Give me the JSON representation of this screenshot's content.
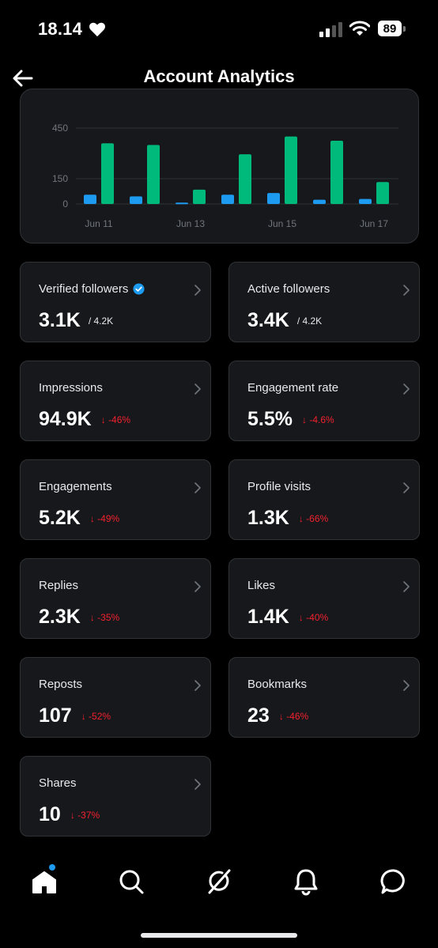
{
  "status": {
    "time": "18.14",
    "battery": "89"
  },
  "header": {
    "title": "Account Analytics"
  },
  "chart_data": {
    "type": "bar",
    "categories": [
      "Jun 11",
      "Jun 12",
      "Jun 13",
      "Jun 14",
      "Jun 15",
      "Jun 16",
      "Jun 17"
    ],
    "x_tick_labels": [
      "Jun 11",
      "Jun 13",
      "Jun 15",
      "Jun 17"
    ],
    "y_tick_labels": [
      "450",
      "150",
      "0"
    ],
    "ylim": [
      0,
      450
    ],
    "grid": true,
    "series": [
      {
        "color": "#1d9bf0",
        "values": [
          55,
          45,
          8,
          55,
          65,
          25,
          30
        ]
      },
      {
        "color": "#00ba7c",
        "values": [
          360,
          350,
          85,
          295,
          400,
          375,
          130
        ]
      }
    ]
  },
  "stats": [
    {
      "label": "Verified followers",
      "value": "3.1K",
      "sub": "/ 4.2K",
      "verified": true
    },
    {
      "label": "Active followers",
      "value": "3.4K",
      "sub": "/ 4.2K"
    },
    {
      "label": "Impressions",
      "value": "94.9K",
      "change": "↓ -46%"
    },
    {
      "label": "Engagement rate",
      "value": "5.5%",
      "change": "↓ -4.6%"
    },
    {
      "label": "Engagements",
      "value": "5.2K",
      "change": "↓ -49%"
    },
    {
      "label": "Profile visits",
      "value": "1.3K",
      "change": "↓ -66%"
    },
    {
      "label": "Replies",
      "value": "2.3K",
      "change": "↓ -35%"
    },
    {
      "label": "Likes",
      "value": "1.4K",
      "change": "↓ -40%"
    },
    {
      "label": "Reposts",
      "value": "107",
      "change": "↓ -52%"
    },
    {
      "label": "Bookmarks",
      "value": "23",
      "change": "↓ -46%"
    },
    {
      "label": "Shares",
      "value": "10",
      "change": "↓ -37%"
    }
  ],
  "tabs": [
    "home-icon",
    "search-icon",
    "grok-icon",
    "notifications-icon",
    "messages-icon"
  ],
  "colors": {
    "accent": "#1d9bf0",
    "green": "#00ba7c",
    "negative": "#f4212e"
  }
}
